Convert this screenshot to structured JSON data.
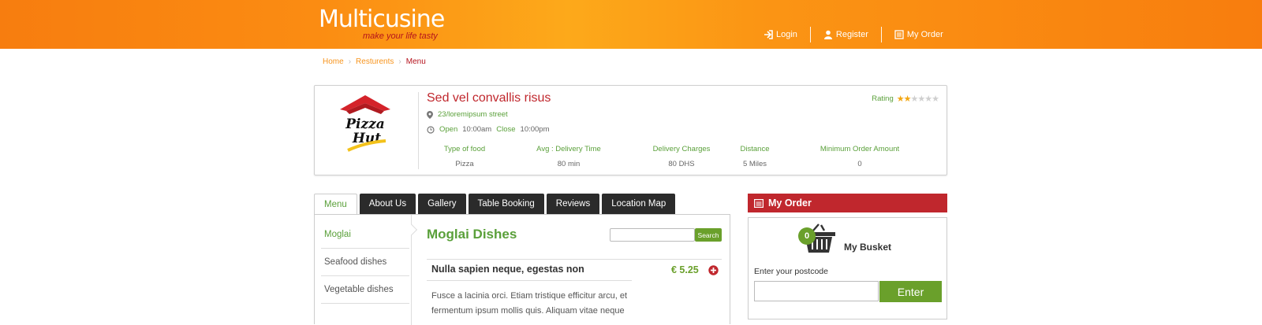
{
  "header": {
    "logo": "Multicusine",
    "tagline": "make your life tasty",
    "nav": [
      {
        "label": "Login",
        "icon": "login-icon"
      },
      {
        "label": "Register",
        "icon": "user-icon"
      },
      {
        "label": "My Order",
        "icon": "order-icon"
      }
    ]
  },
  "breadcrumb": {
    "home": "Home",
    "restaurants": "Resturents",
    "current": "Menu"
  },
  "restaurant": {
    "name": "Sed vel convallis risus",
    "address": "23/loremipsum street",
    "open_label": "Open",
    "open_time": "10:00am",
    "close_label": "Close",
    "close_time": "10:00pm",
    "rating_label": "Rating",
    "rating": 2,
    "rating_max": 6,
    "stats": {
      "type_label": "Type of food",
      "type_value": "Pizza",
      "delivery_label": "Avg : Delivery Time",
      "delivery_value": "80 min",
      "charges_label": "Delivery Charges",
      "charges_value": "80 DHS",
      "distance_label": "Distance",
      "distance_value": "5 Miles",
      "min_order_label": "Minimum Order Amount",
      "min_order_value": "0"
    }
  },
  "tabs": [
    "Menu",
    "About Us",
    "Gallery",
    "Table Booking",
    "Reviews",
    "Location Map"
  ],
  "categories": [
    "Moglai",
    "Seafood dishes",
    "Vegetable dishes"
  ],
  "menu": {
    "section_title": "Moglai Dishes",
    "search_button": "Search",
    "dish_name": "Nulla sapien neque, egestas non",
    "dish_price": "€ 5.25",
    "dish_description": "Fusce a lacinia orci. Etiam tristique efficitur arcu, et fermentum ipsum mollis quis. Aliquam vitae neque"
  },
  "order": {
    "title": "My Order",
    "basket_count": "0",
    "basket_label": "My Busket",
    "postcode_label": "Enter your postcode",
    "enter_button": "Enter"
  },
  "colors": {
    "brand_orange": "#f7941d",
    "brand_red": "#c0272d",
    "accent_green": "#6aa02b"
  }
}
